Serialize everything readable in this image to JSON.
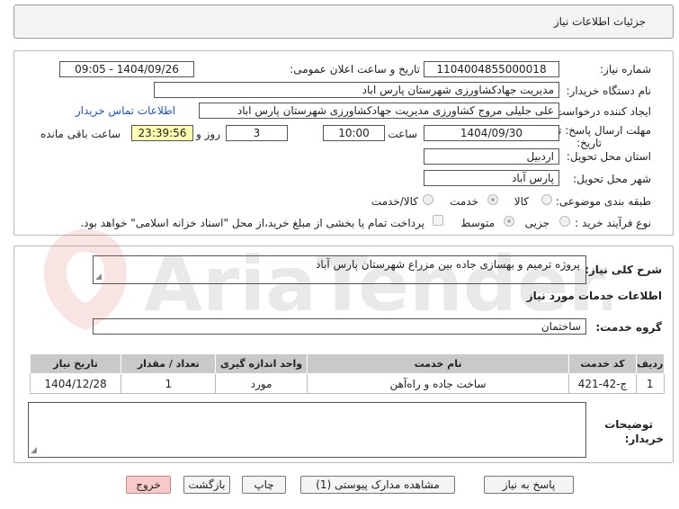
{
  "header": {
    "title": "جزئیات اطلاعات نیاز"
  },
  "form": {
    "need_number_label": "شماره نیاز:",
    "need_number": "1104004855000018",
    "announce_label": "تاریخ و ساعت اعلان عمومی:",
    "announce_value": "1404/09/26 - 09:05",
    "buyer_org_label": "نام دستگاه خریدار:",
    "buyer_org": "مدیریت جهادکشاورزی شهرستان پارس اباد",
    "creator_label": "ایجاد کننده درخواست:",
    "creator": "علی جلیلی مروج کشاورزی مدیریت جهادکشاورزی شهرستان پارس اباد",
    "contact_link": "اطلاعات تماس خریدار",
    "deadline_label_1": "مهلت ارسال پاسخ: تا",
    "deadline_label_2": "تاریخ:",
    "deadline_date": "1404/09/30",
    "time_label": "ساعت",
    "deadline_time": "10:00",
    "days_value": "3",
    "days_label": "روز و",
    "remaining_time": "23:39:56",
    "remaining_label": "ساعت باقی مانده",
    "province_label": "استان محل تحویل:",
    "province": "اردبیل",
    "city_label": "شهر محل تحویل:",
    "city": "پارس آباد",
    "category_label": "طبقه بندی موضوعی:",
    "category_options": [
      "کالا",
      "خدمت",
      "کالا/خدمت"
    ],
    "category_selected": "خدمت",
    "process_label": "نوع فرآیند خرید :",
    "process_options": [
      "جزیی",
      "متوسط"
    ],
    "process_selected": "متوسط",
    "payment_note": "پرداخت تمام یا بخشی از مبلغ خرید،از محل \"اسناد خزانه اسلامی\" خواهد بود."
  },
  "summary": {
    "label": "شرح کلی نیاز:",
    "value": "پروژه ترمیم و بهسازی جاده بین مزراع شهرستان پارس آباد"
  },
  "services": {
    "section_title": "اطلاعات خدمات مورد نیاز",
    "group_label": "گروه خدمت:",
    "group_value": "ساختمان",
    "columns": [
      "ردیف",
      "کد خدمت",
      "نام خدمت",
      "واحد اندازه گیری",
      "تعداد / مقدار",
      "تاریخ نیاز"
    ],
    "rows": [
      {
        "row": "1",
        "code": "ج-42-421",
        "name": "ساخت جاده و راه‌آهن",
        "unit": "مورد",
        "qty": "1",
        "date": "1404/12/28"
      }
    ]
  },
  "notes": {
    "label_1": "توضیحات",
    "label_2": "خریدار:",
    "value": ""
  },
  "buttons": {
    "reply": "پاسخ به نیاز",
    "docs": "مشاهده مدارک پیوستی (1)",
    "print": "چاپ",
    "back": "بازگشت",
    "exit": "خروج"
  },
  "watermark": {
    "text": "AriaTender.net"
  },
  "colors": {
    "remaining_bg": "#ffffb2",
    "link": "#1a53c8",
    "exit_bg": "#f7c9c9",
    "table_header": "#c9c9c9"
  }
}
